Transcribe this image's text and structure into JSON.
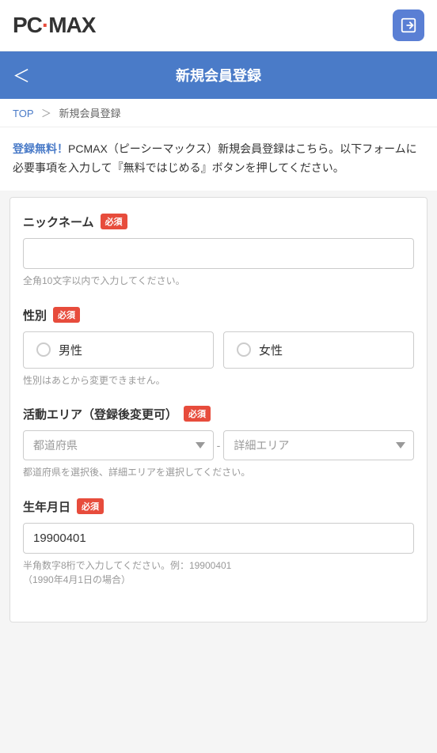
{
  "app": {
    "logo": "PCMAX",
    "logo_dot_char": "·",
    "login_icon": "→"
  },
  "nav": {
    "back_label": "＜",
    "title": "新規会員登録"
  },
  "breadcrumb": {
    "top_label": "TOP",
    "separator": "＞",
    "current": "新規会員登録"
  },
  "intro": {
    "highlight": "登録無料！",
    "text": "PCMAX（ピーシーマックス）新規会員登録はこちら。以下フォームに必要事項を入力して『無料ではじめる』ボタンを押してください。"
  },
  "form": {
    "nickname": {
      "label": "ニックネーム",
      "required": "必須",
      "placeholder": "",
      "hint": "全角10文字以内で入力してください。"
    },
    "gender": {
      "label": "性別",
      "required": "必須",
      "options": [
        {
          "value": "male",
          "label": "男性"
        },
        {
          "value": "female",
          "label": "女性"
        }
      ],
      "note": "性別はあとから変更できません。"
    },
    "area": {
      "label": "活動エリア（登録後変更可）",
      "required": "必須",
      "prefecture_placeholder": "都道府県",
      "detail_placeholder": "詳細エリア",
      "separator": "-",
      "hint": "都道府県を選択後、詳細エリアを選択してください。"
    },
    "birthdate": {
      "label": "生年月日",
      "required": "必須",
      "value": "19900401",
      "hint": "半角数字8桁で入力してください。例：19900401\n（1990年4月1日の場合）"
    }
  },
  "colors": {
    "accent_blue": "#4a7bc8",
    "required_red": "#e74c3c"
  }
}
